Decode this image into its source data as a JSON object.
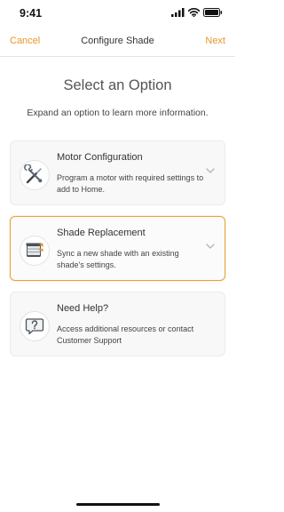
{
  "status_bar": {
    "time": "9:41"
  },
  "nav": {
    "cancel_label": "Cancel",
    "title": "Configure Shade",
    "next_label": "Next"
  },
  "header": {
    "title": "Select an Option",
    "subtitle": "Expand an option to learn more information."
  },
  "options": [
    {
      "title": "Motor Configuration",
      "description": "Program a motor with required settings to add to Home.",
      "icon": "tools-icon",
      "selected": false
    },
    {
      "title": "Shade Replacement",
      "description": "Sync a new shade with an existing shade's settings.",
      "icon": "shade-icon",
      "selected": true
    },
    {
      "title": "Need Help?",
      "description": "Access additional resources or contact Customer Support",
      "icon": "help-bubble-icon",
      "selected": false
    }
  ],
  "colors": {
    "accent": "#e8962a",
    "selected_border": "#e8a238",
    "card_background": "#f8f8f8"
  }
}
